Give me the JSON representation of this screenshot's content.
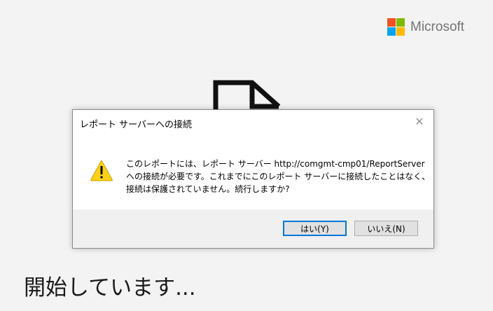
{
  "splash": {
    "brand_name": "Microsoft",
    "brand_colors": [
      "#f25022",
      "#7fba00",
      "#00a4ef",
      "#ffb900"
    ],
    "document_icon": "document-icon",
    "status_text": "開始しています..."
  },
  "dialog": {
    "title": "レポート サーバーへの接続",
    "close_glyph": "✕",
    "icon": "warning-icon",
    "message_lines": [
      "このレポートには、レポート サーバー http://comgmt-cmp01/ReportServer",
      "への接続が必要です。これまでにこのレポート サーバーに接続したことはなく、",
      "接続は保護されていません。続行しますか?"
    ],
    "buttons": {
      "yes": "はい(Y)",
      "no": "いいえ(N)"
    },
    "accent_color": "#0078d7"
  }
}
